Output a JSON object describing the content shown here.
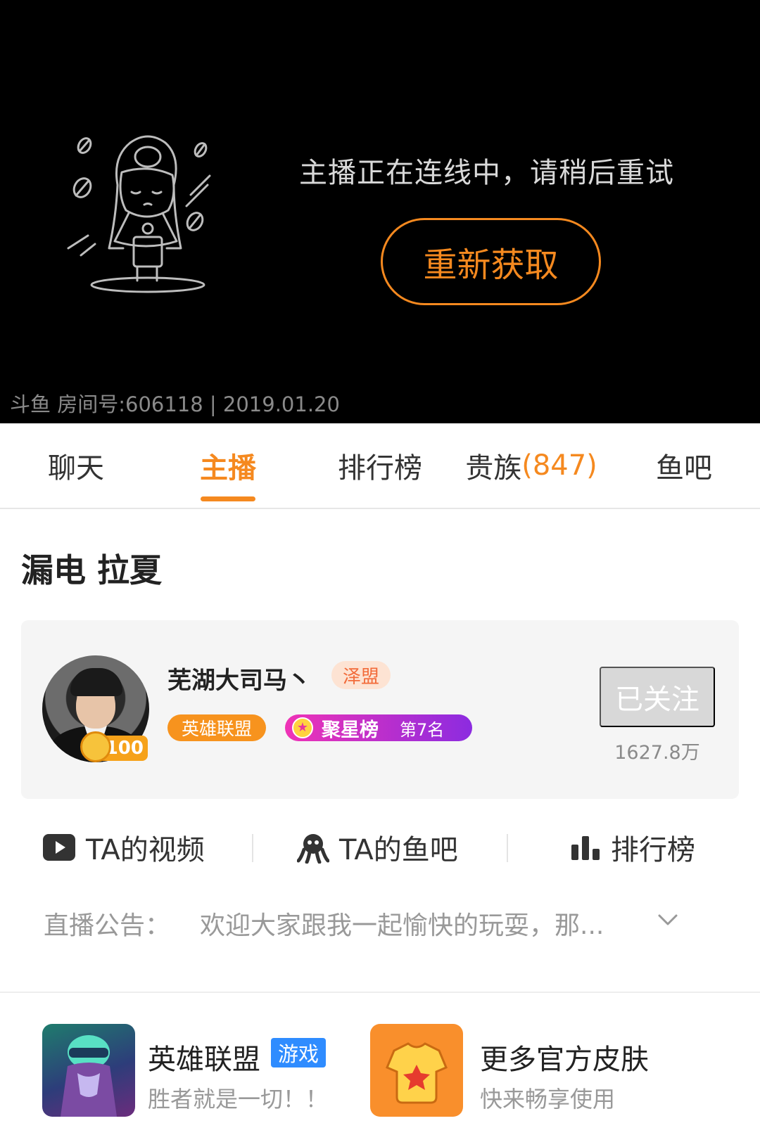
{
  "player": {
    "message": "主播正在连线中，请稍后重试",
    "retry_label": "重新获取",
    "room_info": "斗鱼 房间号:606118 | 2019.01.20"
  },
  "tabs": [
    {
      "label": "聊天",
      "active": false
    },
    {
      "label": "主播",
      "active": true
    },
    {
      "label": "排行榜",
      "active": false
    },
    {
      "label": "贵族",
      "count": "(847)",
      "active": false
    },
    {
      "label": "鱼吧",
      "active": false
    }
  ],
  "room_title": "漏电 拉夏",
  "anchor": {
    "name": "芜湖大司马丶",
    "clan": "泽盟",
    "level": "100",
    "game_tag": "英雄联盟",
    "star_rank_label": "聚星榜",
    "star_rank_value": "第7名",
    "follow_label": "已关注",
    "fans": "1627.8万"
  },
  "actions": {
    "videos": "TA的视频",
    "fishbar": "TA的鱼吧",
    "ranking": "排行榜"
  },
  "notice": {
    "head": "直播公告：",
    "body": "欢迎大家跟我一起愉快的玩耍，那..."
  },
  "promos": {
    "game": {
      "title": "英雄联盟",
      "badge": "游戏",
      "subtitle": "胜者就是一切！！"
    },
    "skins": {
      "title": "更多官方皮肤",
      "subtitle": "快来畅享使用"
    }
  },
  "colors": {
    "accent": "#f5891f",
    "star_gradient_start": "#ef33b6",
    "star_gradient_end": "#8c2be0",
    "badge_blue": "#2f8cff"
  },
  "icons": {
    "illustration": "sad-anchor-illustration",
    "videos": "play-icon",
    "fishbar": "octopus-icon",
    "ranking": "bar-chart-icon",
    "notice_expand": "chevron-down-icon",
    "star": "star-icon",
    "skins": "tshirt-star-icon"
  }
}
